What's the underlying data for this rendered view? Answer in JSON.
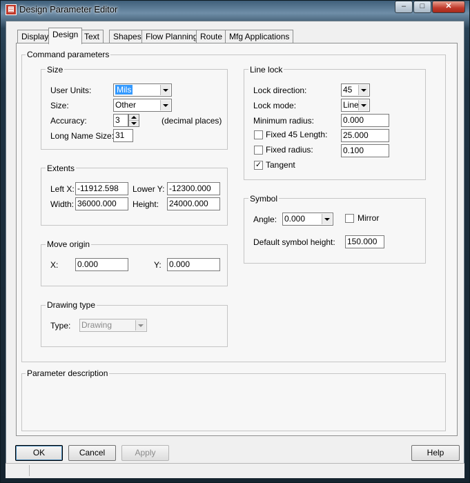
{
  "window": {
    "title": "Design Parameter Editor",
    "caption_buttons": {
      "minimize": "–",
      "maximize": "□",
      "close": "✕"
    }
  },
  "tabs": [
    {
      "label": "Display"
    },
    {
      "label": "Design"
    },
    {
      "label": "Text"
    },
    {
      "label": "Shapes"
    },
    {
      "label": "Flow Planning"
    },
    {
      "label": "Route"
    },
    {
      "label": "Mfg Applications"
    }
  ],
  "selected_tab": "Design",
  "command_parameters": {
    "title": "Command parameters",
    "size": {
      "title": "Size",
      "user_units_label": "User Units:",
      "user_units_value": "Mils",
      "size_label": "Size:",
      "size_value": "Other",
      "accuracy_label": "Accuracy:",
      "accuracy_value": "3",
      "accuracy_hint": "(decimal places)",
      "long_name_label": "Long Name Size:",
      "long_name_value": "31"
    },
    "extents": {
      "title": "Extents",
      "left_x_label": "Left X:",
      "left_x_value": "-11912.598",
      "lower_y_label": "Lower Y:",
      "lower_y_value": "-12300.000",
      "width_label": "Width:",
      "width_value": "36000.000",
      "height_label": "Height:",
      "height_value": "24000.000"
    },
    "move_origin": {
      "title": "Move origin",
      "x_label": "X:",
      "x_value": "0.000",
      "y_label": "Y:",
      "y_value": "0.000"
    },
    "drawing_type": {
      "title": "Drawing type",
      "type_label": "Type:",
      "type_value": "Drawing"
    },
    "line_lock": {
      "title": "Line lock",
      "lock_direction_label": "Lock direction:",
      "lock_direction_value": "45",
      "lock_mode_label": "Lock mode:",
      "lock_mode_value": "Line",
      "minimum_radius_label": "Minimum radius:",
      "minimum_radius_value": "0.000",
      "fixed45_label": "Fixed 45 Length:",
      "fixed45_value": "25.000",
      "fixed45_checked": false,
      "fixed_radius_label": "Fixed radius:",
      "fixed_radius_value": "0.100",
      "fixed_radius_checked": false,
      "tangent_label": "Tangent",
      "tangent_checked": true,
      "check_mark": "✓"
    },
    "symbol": {
      "title": "Symbol",
      "angle_label": "Angle:",
      "angle_value": "0.000",
      "mirror_label": "Mirror",
      "mirror_checked": false,
      "default_height_label": "Default symbol height:",
      "default_height_value": "150.000"
    }
  },
  "parameter_description": {
    "title": "Parameter description"
  },
  "buttons": {
    "ok": "OK",
    "cancel": "Cancel",
    "apply": "Apply",
    "help": "Help"
  }
}
